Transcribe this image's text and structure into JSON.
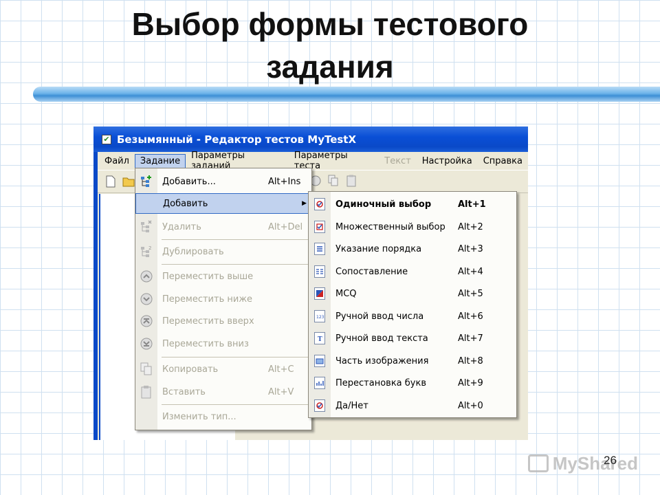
{
  "slide": {
    "title_line1": "Выбор формы тестового",
    "title_line2": "задания",
    "page_number": "26",
    "watermark": "MyShared"
  },
  "window": {
    "title": "Безымянный - Редактор тестов MyTestX"
  },
  "menubar": {
    "items": [
      "Файл",
      "Задание",
      "Параметры заданий",
      "Параметры теста",
      "Текст",
      "Настройка",
      "Справка"
    ]
  },
  "menu_task": {
    "items": [
      {
        "label": "Добавить...",
        "shortcut": "Alt+Ins"
      },
      {
        "label": "Добавить",
        "shortcut": ""
      },
      {
        "label": "Удалить",
        "shortcut": "Alt+Del"
      },
      {
        "label": "Дублировать",
        "shortcut": ""
      },
      {
        "label": "Переместить выше",
        "shortcut": ""
      },
      {
        "label": "Переместить ниже",
        "shortcut": ""
      },
      {
        "label": "Переместить вверх",
        "shortcut": ""
      },
      {
        "label": "Переместить вниз",
        "shortcut": ""
      },
      {
        "label": "Копировать",
        "shortcut": "Alt+C"
      },
      {
        "label": "Вставить",
        "shortcut": "Alt+V"
      },
      {
        "label": "Изменить тип...",
        "shortcut": ""
      }
    ]
  },
  "menu_add": {
    "items": [
      {
        "label": "Одиночный выбор",
        "shortcut": "Alt+1"
      },
      {
        "label": "Множественный выбор",
        "shortcut": "Alt+2"
      },
      {
        "label": "Указание порядка",
        "shortcut": "Alt+3"
      },
      {
        "label": "Сопоставление",
        "shortcut": "Alt+4"
      },
      {
        "label": "MCQ",
        "shortcut": "Alt+5"
      },
      {
        "label": "Ручной ввод числа",
        "shortcut": "Alt+6"
      },
      {
        "label": "Ручной ввод текста",
        "shortcut": "Alt+7"
      },
      {
        "label": "Часть изображения",
        "shortcut": "Alt+8"
      },
      {
        "label": "Перестановка букв",
        "shortcut": "Alt+9"
      },
      {
        "label": "Да/Нет",
        "shortcut": "Alt+0"
      }
    ]
  },
  "icons": {
    "app": "checkbox-icon",
    "task_add_dialog": "tree-add-icon",
    "task_delete": "tree-delete-icon",
    "task_duplicate": "tree-duplicate-icon",
    "move_up": "arrow-up-circle-icon",
    "move_down": "arrow-down-circle-icon",
    "move_top": "arrow-top-circle-icon",
    "move_bottom": "arrow-bottom-circle-icon",
    "copy": "copy-icon",
    "paste": "paste-icon"
  },
  "colors": {
    "titlebar": "#0a49c8",
    "menu_highlight": "#c1d2ee",
    "menu_highlight_border": "#316ac5",
    "disabled_text": "#a9a797",
    "accent_stripe": "#3d8fd6"
  }
}
